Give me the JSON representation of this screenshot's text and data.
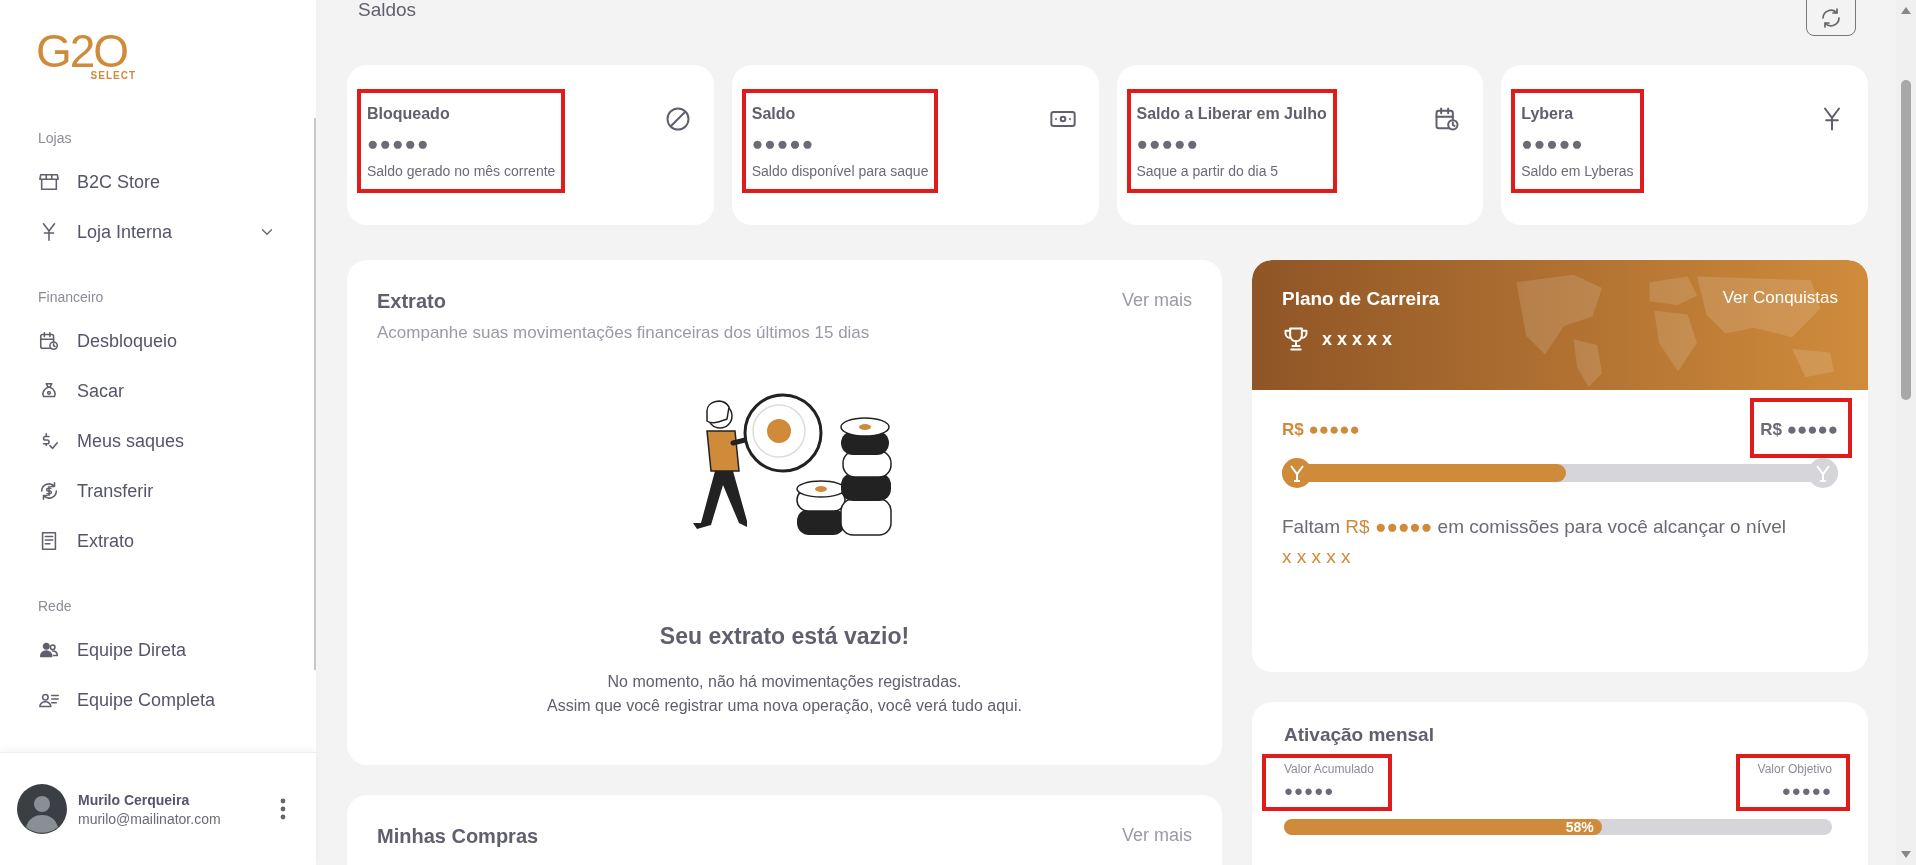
{
  "sidebar": {
    "logo": {
      "mark": "G2O",
      "sub": "SELECT"
    },
    "sections": [
      {
        "title": "Lojas",
        "items": [
          {
            "label": "B2C Store",
            "has_submenu": false
          },
          {
            "label": "Loja Interna",
            "has_submenu": true,
            "expanded": false
          }
        ]
      },
      {
        "title": "Financeiro",
        "items": [
          {
            "label": "Desbloqueio",
            "has_submenu": false
          },
          {
            "label": "Sacar",
            "has_submenu": false
          },
          {
            "label": "Meus saques",
            "has_submenu": false
          },
          {
            "label": "Transferir",
            "has_submenu": false
          },
          {
            "label": "Extrato",
            "has_submenu": false
          }
        ]
      },
      {
        "title": "Rede",
        "items": [
          {
            "label": "Equipe Direta",
            "has_submenu": false
          },
          {
            "label": "Equipe Completa",
            "has_submenu": false
          }
        ]
      }
    ],
    "user": {
      "name": "Murilo Cerqueira",
      "email": "murilo@mailinator.com"
    }
  },
  "main": {
    "title": "Saldos",
    "balance_cards": [
      {
        "title": "Bloqueado",
        "value": "●●●●●",
        "caption": "Saldo gerado no mês corrente",
        "highlighted": true
      },
      {
        "title": "Saldo",
        "value": "●●●●●",
        "caption": "Saldo disponível para saque",
        "highlighted": true
      },
      {
        "title": "Saldo a Liberar em Julho",
        "value": "●●●●●",
        "caption": "Saque a partir do dia 5",
        "highlighted": true
      },
      {
        "title": "Lybera",
        "value": "●●●●●",
        "caption": "Saldo em Lyberas",
        "highlighted": true
      }
    ],
    "extract": {
      "title": "Extrato",
      "link": "Ver mais",
      "subtitle": "Acompanhe suas movimentações financeiras dos últimos 15 dias",
      "empty_title": "Seu extrato está vazio!",
      "empty_lines": [
        "No momento, não há movimentações registradas.",
        "Assim que você registrar uma nova operação, você verá tudo aqui."
      ]
    },
    "purchases": {
      "title": "Minhas Compras",
      "link": "Ver mais"
    },
    "career": {
      "title": "Plano de Carreira",
      "link": "Ver Conquistas",
      "rank": "x x x x x",
      "current": "R$ ●●●●●",
      "target": "R$ ●●●●●",
      "target_highlighted": true,
      "level": 0.51,
      "message": {
        "before": "Faltam",
        "amount": "R$ ●●●●●",
        "after": "em comissões para você alcançar o nível",
        "next_level": "x x x x x"
      }
    },
    "activation": {
      "title": "Ativação mensal",
      "accumulated_label": "Valor Acumulado",
      "accumulated_value": "●●●●●",
      "accumulated_highlighted": true,
      "goal_label": "Valor Objetivo",
      "goal_value": "●●●●●",
      "goal_highlighted": true,
      "level": 0.58,
      "reading": "58%"
    }
  }
}
